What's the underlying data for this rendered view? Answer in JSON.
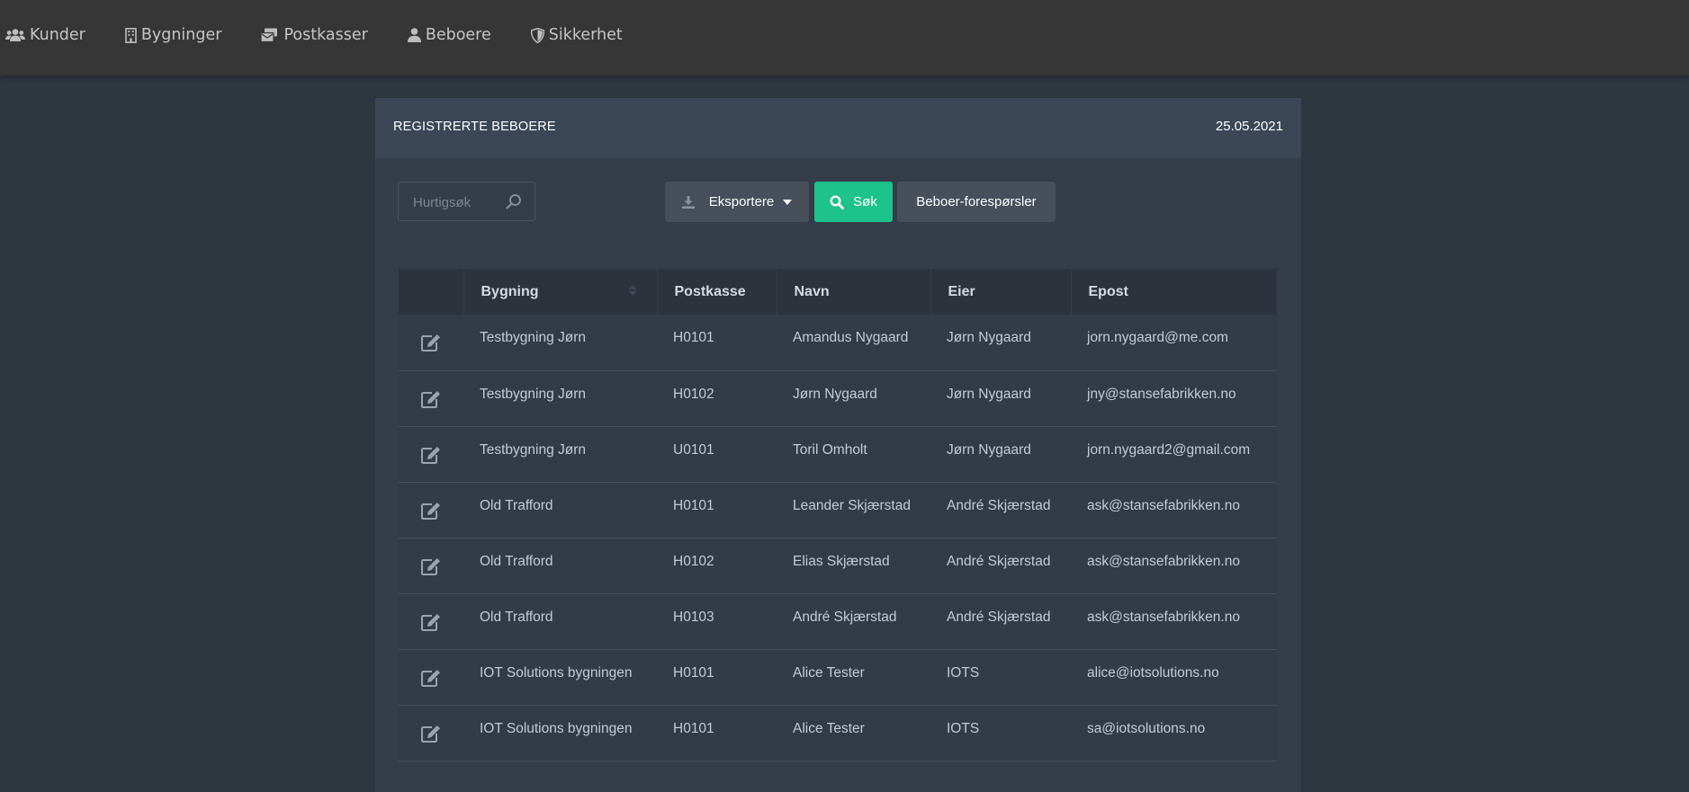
{
  "nav": {
    "items": [
      {
        "label": "Kunder",
        "icon": "users-icon"
      },
      {
        "label": "Bygninger",
        "icon": "building-icon"
      },
      {
        "label": "Postkasser",
        "icon": "mailbox-icon"
      },
      {
        "label": "Beboere",
        "icon": "user-icon"
      },
      {
        "label": "Sikkerhet",
        "icon": "shield-icon"
      }
    ]
  },
  "card": {
    "title": "REGISTRERTE BEBOERE",
    "date": "25.05.2021"
  },
  "toolbar": {
    "search_placeholder": "Hurtigsøk",
    "export_label": "Eksportere",
    "search_label": "Søk",
    "requests_label": "Beboer-forespørsler"
  },
  "colors": {
    "accent": "#1ec28b",
    "nav_bg": "#363636",
    "page_bg": "#2e3640",
    "card_bg": "#343d49"
  },
  "table": {
    "headers": [
      "",
      "Bygning",
      "Postkasse",
      "Navn",
      "Eier",
      "Epost"
    ],
    "rows": [
      [
        "Testbygning Jørn",
        "H0101",
        "Amandus Nygaard",
        "Jørn Nygaard",
        "jorn.nygaard@me.com"
      ],
      [
        "Testbygning Jørn",
        "H0102",
        "Jørn Nygaard",
        "Jørn Nygaard",
        "jny@stansefabrikken.no"
      ],
      [
        "Testbygning Jørn",
        "U0101",
        "Toril Omholt",
        "Jørn Nygaard",
        "jorn.nygaard2@gmail.com"
      ],
      [
        "Old Trafford",
        "H0101",
        "Leander Skjærstad",
        "André Skjærstad",
        "ask@stansefabrikken.no"
      ],
      [
        "Old Trafford",
        "H0102",
        "Elias Skjærstad",
        "André Skjærstad",
        "ask@stansefabrikken.no"
      ],
      [
        "Old Trafford",
        "H0103",
        "André Skjærstad",
        "André Skjærstad",
        "ask@stansefabrikken.no"
      ],
      [
        "IOT Solutions bygningen",
        "H0101",
        "Alice Tester",
        "IOTS",
        "alice@iotsolutions.no"
      ],
      [
        "IOT Solutions bygningen",
        "H0101",
        "Alice Tester",
        "IOTS",
        "sa@iotsolutions.no"
      ]
    ]
  }
}
